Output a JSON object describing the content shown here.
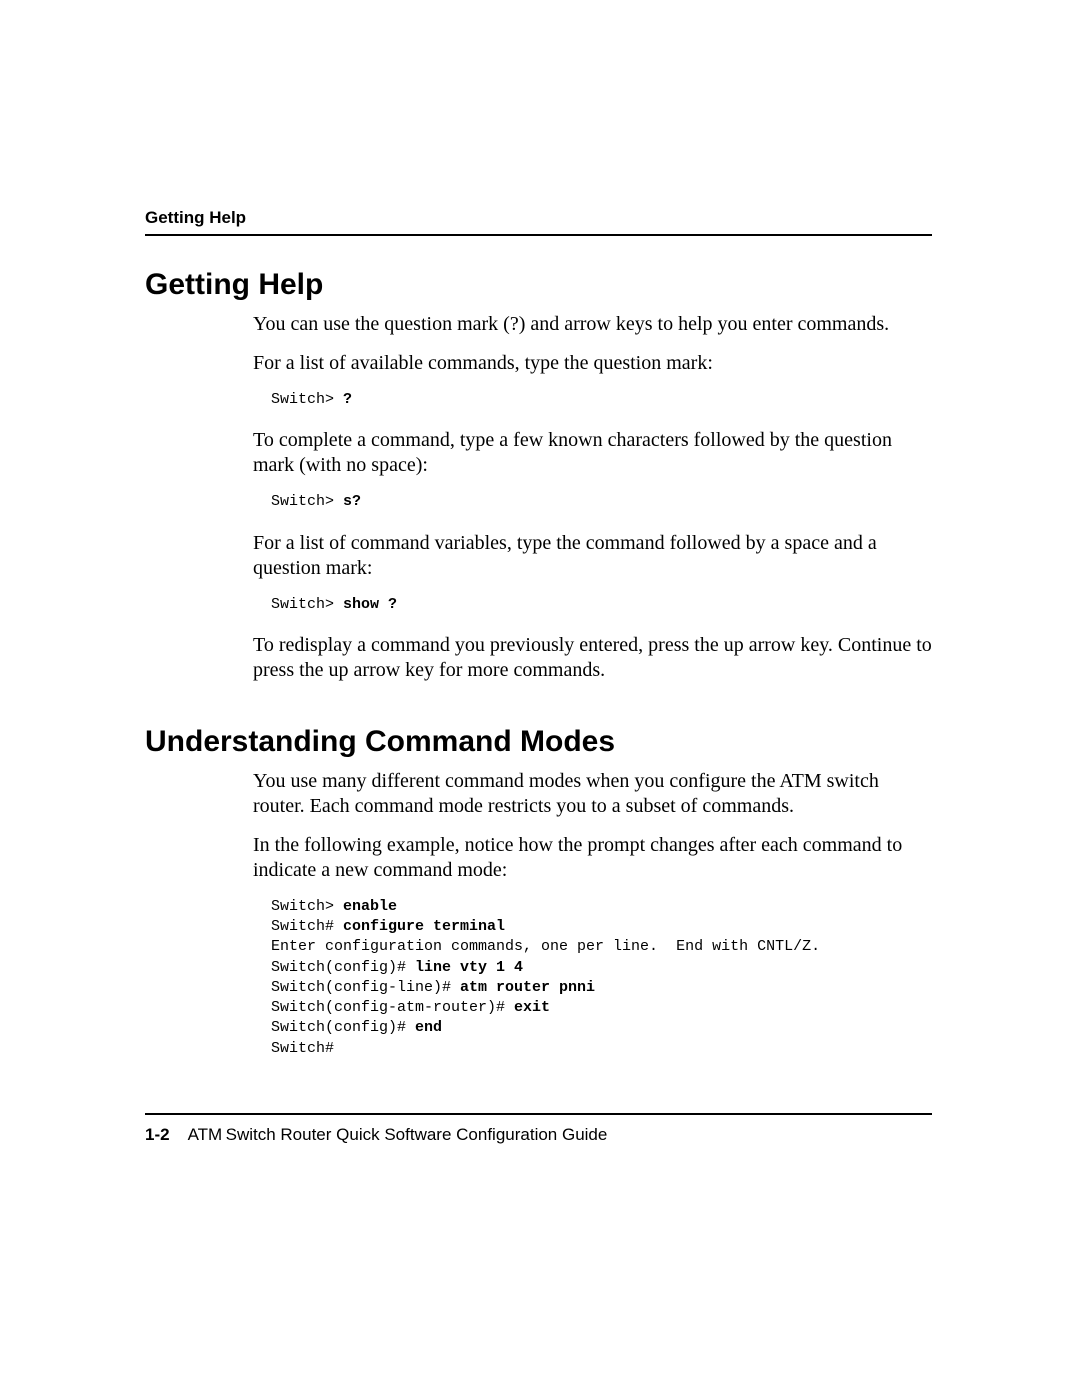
{
  "running_head": "Getting Help",
  "sections": {
    "help": {
      "heading": "Getting Help",
      "p1": "You can use the question mark (?) and arrow keys to help you enter commands.",
      "p2": "For a list of available commands, type the question mark:",
      "code1_prompt": "Switch> ",
      "code1_bold": "?",
      "p3": "To complete a command, type a few known characters followed by the question mark (with no space):",
      "code2_prompt": "Switch> ",
      "code2_bold": "s?",
      "p4": "For a list of command variables, type the command followed by a space and a question mark:",
      "code3_prompt": "Switch> ",
      "code3_bold": "show ?",
      "p5": "To redisplay a command you previously entered, press the up arrow key. Continue to press the up arrow key for more commands."
    },
    "modes": {
      "heading": "Understanding Command Modes",
      "p1": "You use many different command modes when you configure the ATM switch router. Each command mode restricts you to a subset of commands.",
      "p2": "In the following example, notice how the prompt changes after each command to indicate a new command mode:",
      "code_lines": {
        "l1_prompt": "Switch> ",
        "l1_bold": "enable",
        "l2_prompt": "Switch# ",
        "l2_bold": "configure terminal",
        "l3": "Enter configuration commands, one per line.  End with CNTL/Z.",
        "l4_prompt": "Switch(config)# ",
        "l4_bold": "line vty 1 4",
        "l5_prompt": "Switch(config-line)# ",
        "l5_bold": "atm router pnni",
        "l6_prompt": "Switch(config-atm-router)# ",
        "l6_bold": "exit",
        "l7_prompt": "Switch(config)# ",
        "l7_bold": "end",
        "l8": "Switch#"
      }
    }
  },
  "footer": {
    "page": "1-2",
    "title": "ATM Switch Router Quick Software Configuration Guide"
  }
}
